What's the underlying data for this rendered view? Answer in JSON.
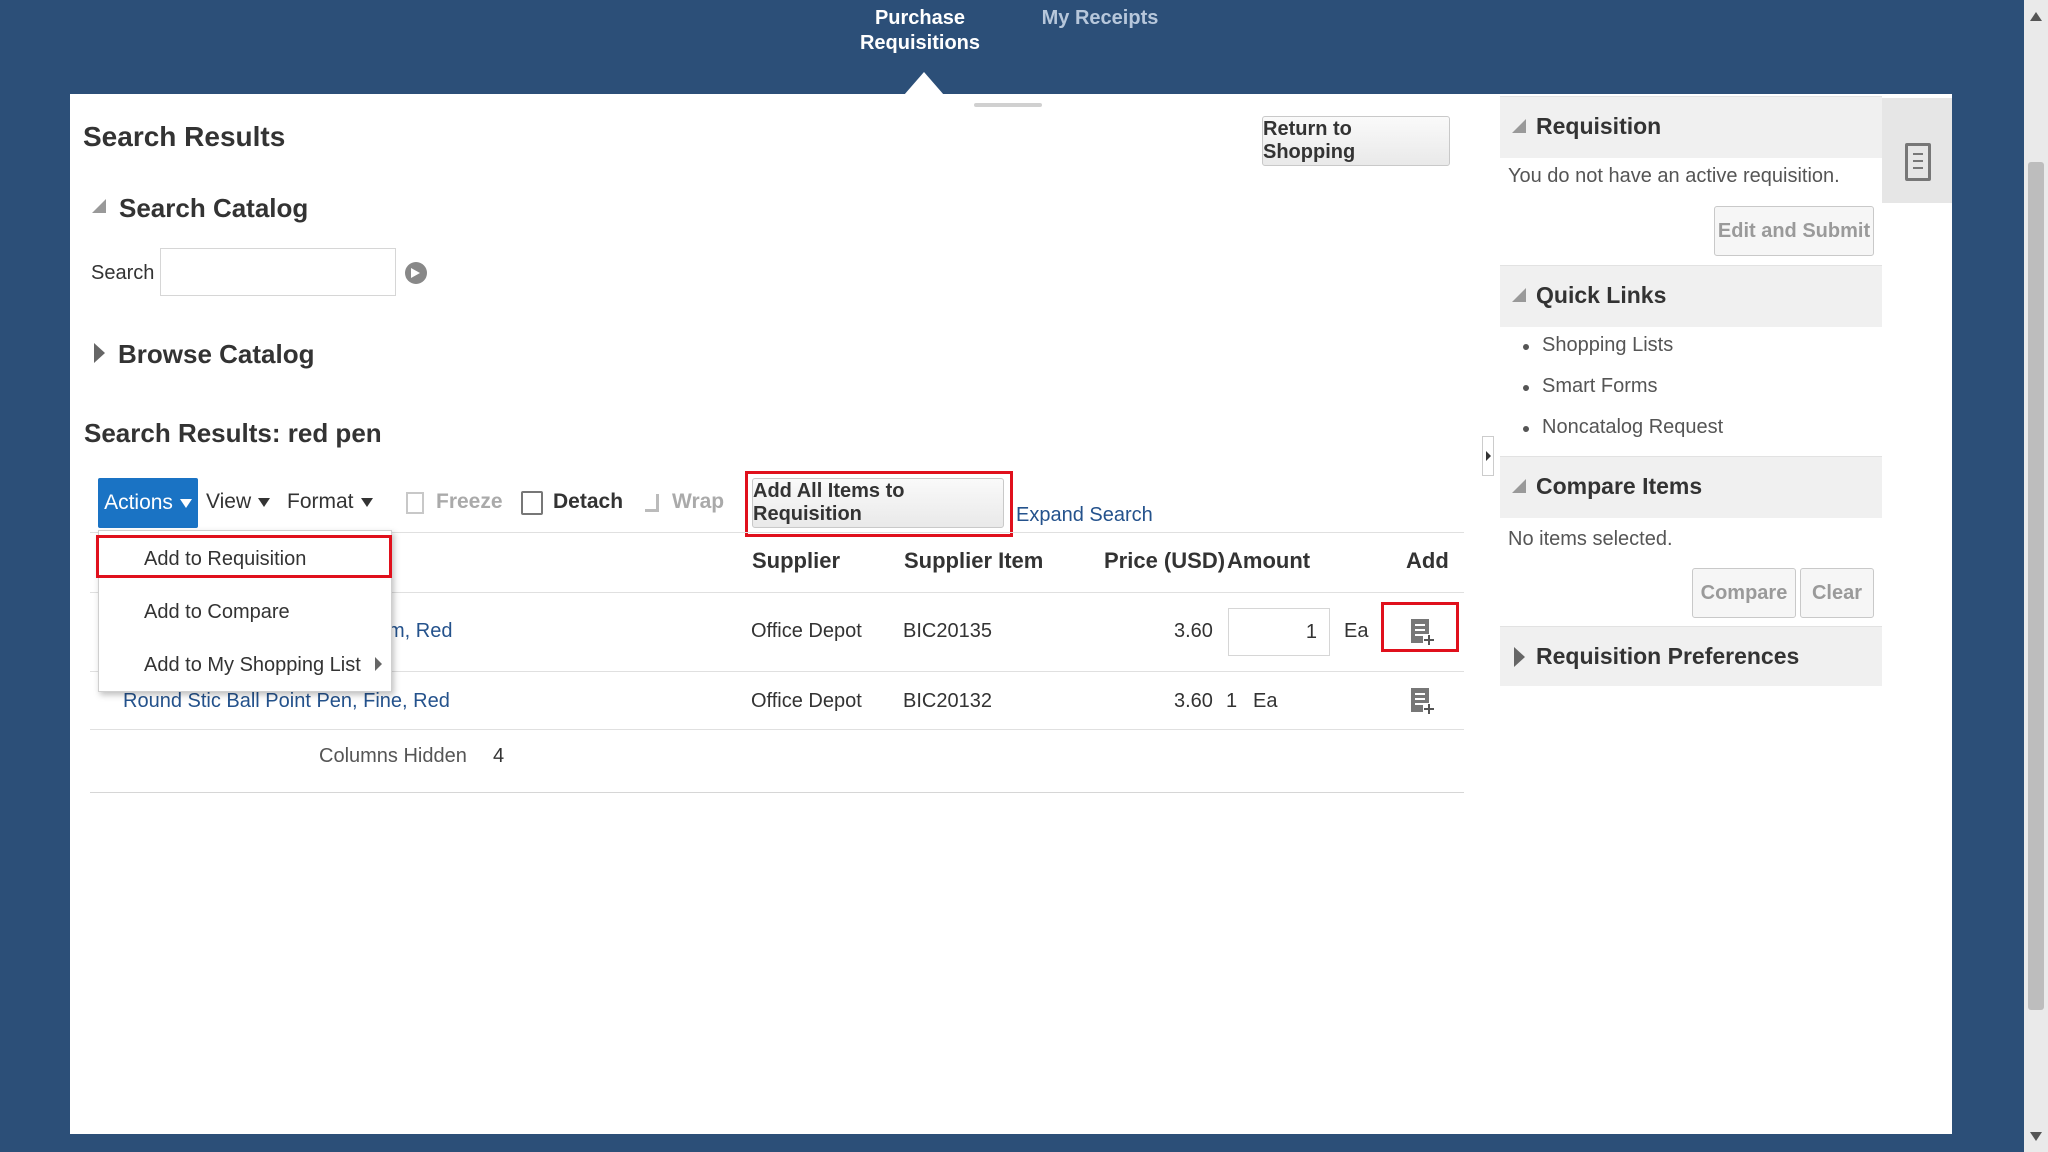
{
  "topnav": {
    "tab_purchase_line1": "Purchase",
    "tab_purchase_line2": "Requisitions",
    "tab_receipts": "My Receipts"
  },
  "page": {
    "title": "Search Results",
    "return_button": "Return to Shopping"
  },
  "search_catalog": {
    "header": "Search Catalog",
    "search_label": "Search",
    "search_value": ""
  },
  "browse_catalog": {
    "header": "Browse Catalog"
  },
  "results": {
    "header": "Search Results: red pen",
    "toolbar": {
      "actions": "Actions",
      "view": "View",
      "format": "Format",
      "freeze": "Freeze",
      "detach": "Detach",
      "wrap": "Wrap",
      "add_all": "Add All Items to Requisition",
      "expand_search": "Expand Search"
    },
    "columns": {
      "supplier": "Supplier",
      "supplier_item": "Supplier Item",
      "price": "Price (USD)",
      "amount": "Amount",
      "add": "Add"
    },
    "rows": [
      {
        "description_visible": "m, Red",
        "supplier": "Office Depot",
        "supplier_item": "BIC20135",
        "price": "3.60",
        "amount": "1",
        "uom": "Ea"
      },
      {
        "description_visible": "Round Stic Ball Point Pen, Fine, Red",
        "supplier": "Office Depot",
        "supplier_item": "BIC20132",
        "price": "3.60",
        "amount": "1",
        "uom": "Ea"
      }
    ],
    "columns_hidden_label": "Columns Hidden",
    "columns_hidden_count": "4"
  },
  "actions_menu": {
    "items": [
      "Add to Requisition",
      "Add to Compare",
      "Add to My Shopping List"
    ]
  },
  "sidebar": {
    "requisition": {
      "header": "Requisition",
      "message": "You do not have an active requisition.",
      "edit_submit": "Edit and Submit"
    },
    "quick_links": {
      "header": "Quick Links",
      "items": [
        "Shopping Lists",
        "Smart Forms",
        "Noncatalog Request"
      ]
    },
    "compare_items": {
      "header": "Compare Items",
      "message": "No items selected.",
      "compare": "Compare",
      "clear": "Clear"
    },
    "preferences": {
      "header": "Requisition Preferences"
    }
  },
  "colors": {
    "background": "#2c4f78",
    "actions_button": "#1a73c4",
    "highlight": "#e0101c"
  }
}
